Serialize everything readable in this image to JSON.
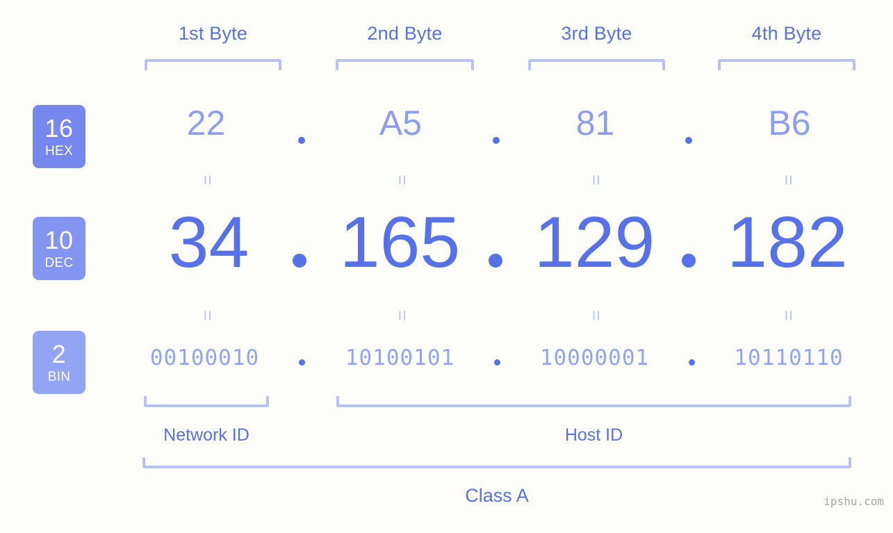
{
  "page": {
    "background_color": "#fdfefa",
    "accent_color": "#5771e8",
    "light_accent_color": "#b8c2f7",
    "watermark": "ipshu.com"
  },
  "byte_headers": [
    {
      "label": "1st Byte"
    },
    {
      "label": "2nd Byte"
    },
    {
      "label": "3rd Byte"
    },
    {
      "label": "4th Byte"
    }
  ],
  "bases": [
    {
      "number": "16",
      "name": "HEX",
      "color": "#7688ee"
    },
    {
      "number": "10",
      "name": "DEC",
      "color": "#8395f0"
    },
    {
      "number": "2",
      "name": "BIN",
      "color": "#93a4f5"
    }
  ],
  "separators": {
    "dot": "."
  },
  "equals_sign": "=",
  "rows": {
    "hex": {
      "base": "16",
      "label": "HEX",
      "values": [
        "22",
        "A5",
        "81",
        "B6"
      ],
      "color": "#8e9cf2"
    },
    "dec": {
      "base": "10",
      "label": "DEC",
      "values": [
        "34",
        "165",
        "129",
        "182"
      ],
      "color": "#5771e8"
    },
    "bin": {
      "base": "2",
      "label": "BIN",
      "values": [
        "00100010",
        "10100101",
        "10000001",
        "10110110"
      ],
      "color": "#93a4f5"
    }
  },
  "ip_address": "34.165.129.182",
  "segments": {
    "network_id": "Network ID",
    "host_id": "Host ID",
    "class": "Class A"
  }
}
